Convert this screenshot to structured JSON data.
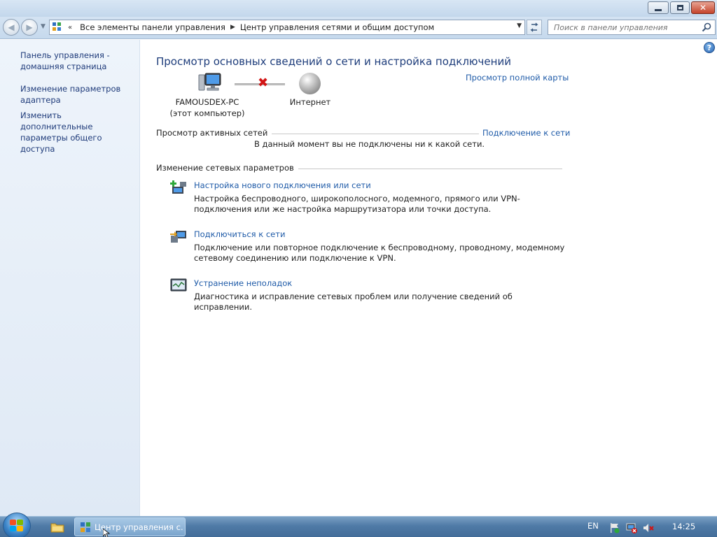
{
  "window": {
    "controls": [
      "minimize",
      "maximize",
      "close"
    ]
  },
  "nav": {
    "address_chevron": "«",
    "breadcrumbs": [
      "Все элементы панели управления",
      "Центр управления сетями и общим доступом"
    ],
    "search_placeholder": "Поиск в панели управления"
  },
  "sidebar": {
    "items": [
      {
        "label": "Панель управления - домашняя страница"
      },
      {
        "label": "Изменение параметров адаптера"
      },
      {
        "label": "Изменить дополнительные параметры общего доступа"
      }
    ]
  },
  "main": {
    "title": "Просмотр основных сведений о сети и настройка подключений",
    "full_map_link": "Просмотр полной карты",
    "map": {
      "computer_name": "FAMOUSDEX-PC",
      "computer_sub": "(этот компьютер)",
      "internet_label": "Интернет"
    },
    "active_networks": {
      "heading": "Просмотр активных сетей",
      "connect_link": "Подключение к сети",
      "status_text": "В данный момент вы не подключены ни к какой сети."
    },
    "change_settings": {
      "heading": "Изменение сетевых параметров",
      "tasks": [
        {
          "link": "Настройка нового подключения или сети",
          "desc": "Настройка беспроводного, широкополосного, модемного, прямого или VPN-подключения или же настройка маршрутизатора или точки доступа."
        },
        {
          "link": "Подключиться к сети",
          "desc": "Подключение или повторное подключение к беспроводному, проводному, модемному сетевому соединению или подключение к VPN."
        },
        {
          "link": "Устранение неполадок",
          "desc": "Диагностика и исправление сетевых проблем или получение сведений об исправлении."
        }
      ]
    }
  },
  "taskbar": {
    "active_task": "Центр управления с...",
    "language": "EN",
    "clock": "14:25"
  },
  "colors": {
    "link": "#1f5ba8",
    "title": "#1e3d7b",
    "sidebar_link": "#1f3b7a",
    "error_x": "#d21414"
  }
}
